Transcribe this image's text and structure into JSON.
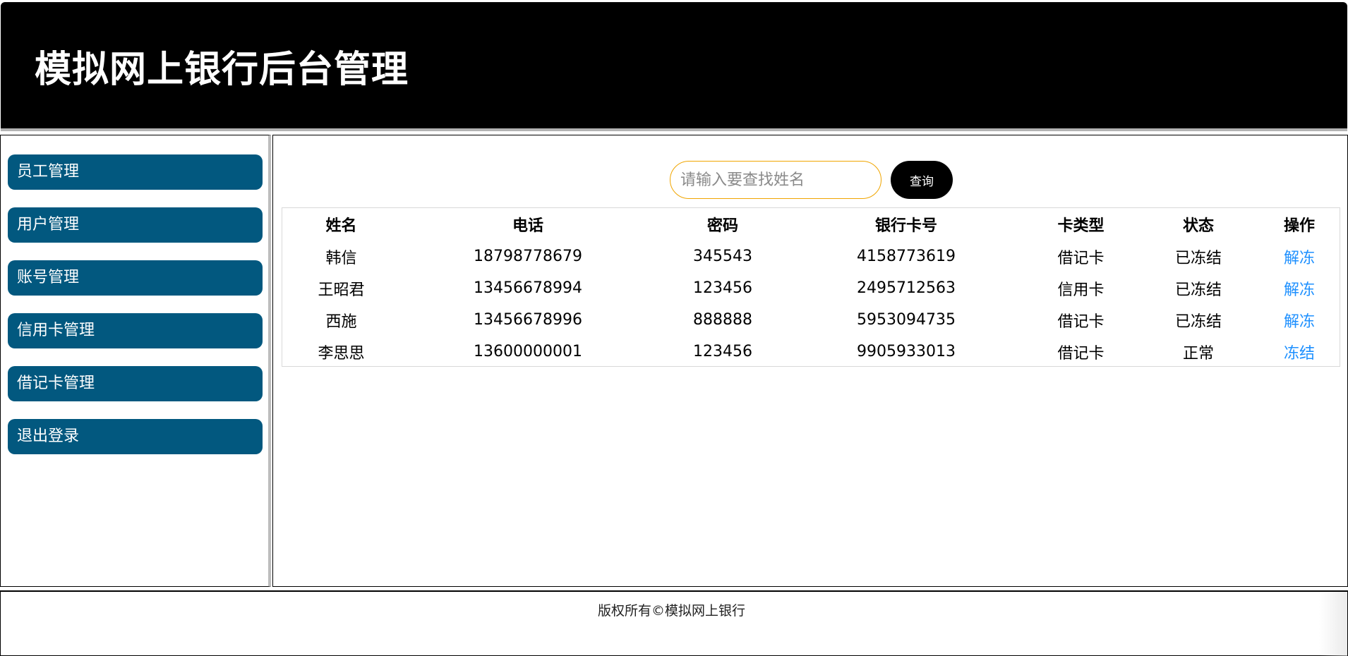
{
  "header": {
    "title": "模拟网上银行后台管理"
  },
  "sidebar": {
    "items": [
      {
        "label": "员工管理"
      },
      {
        "label": "用户管理"
      },
      {
        "label": "账号管理"
      },
      {
        "label": "信用卡管理"
      },
      {
        "label": "借记卡管理"
      },
      {
        "label": "退出登录"
      }
    ]
  },
  "search": {
    "placeholder": "请输入要查找姓名",
    "value": "",
    "button_label": "查询"
  },
  "table": {
    "headers": [
      "姓名",
      "电话",
      "密码",
      "银行卡号",
      "卡类型",
      "状态",
      "操作"
    ],
    "rows": [
      [
        "韩信",
        "18798778679",
        "345543",
        "4158773619",
        "借记卡",
        "已冻结",
        "解冻"
      ],
      [
        "王昭君",
        "13456678994",
        "123456",
        "2495712563",
        "信用卡",
        "已冻结",
        "解冻"
      ],
      [
        "西施",
        "13456678996",
        "888888",
        "5953094735",
        "借记卡",
        "已冻结",
        "解冻"
      ],
      [
        "李思思",
        "13600000001",
        "123456",
        "9905933013",
        "借记卡",
        "正常",
        "冻结"
      ]
    ]
  },
  "footer": {
    "text": "版权所有©模拟网上银行"
  },
  "colors": {
    "header_bg": "#000000",
    "nav_bg": "#02587f",
    "link": "#1e90ff",
    "search_border": "#f0a500"
  }
}
